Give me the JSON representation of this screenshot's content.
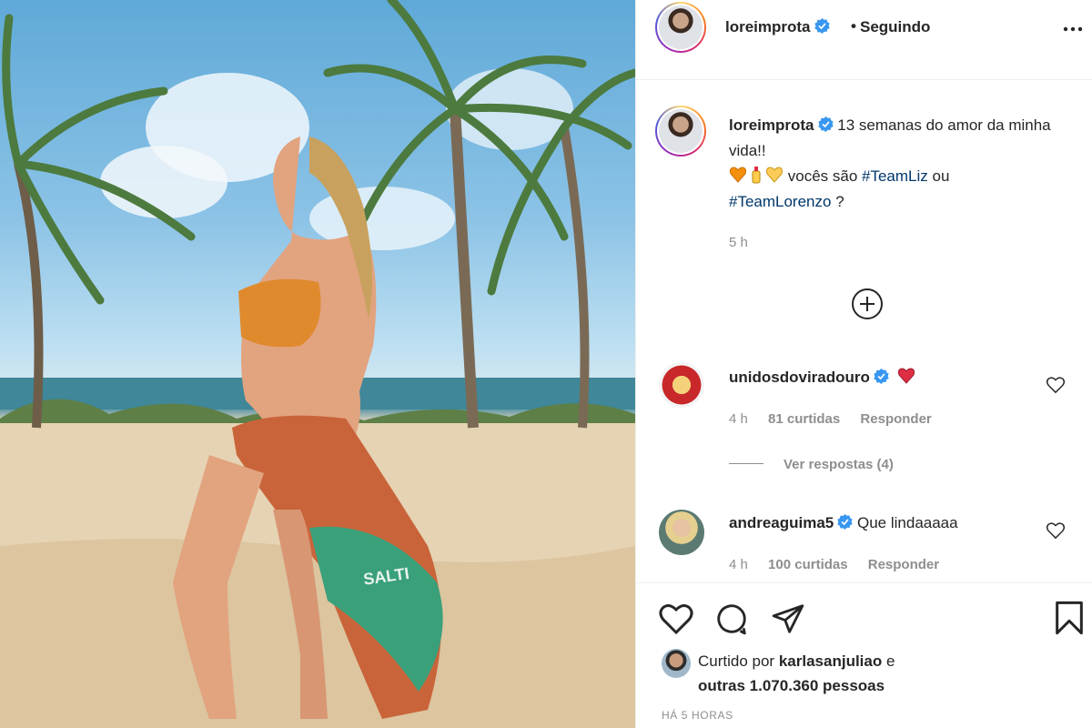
{
  "post": {
    "photo_overlay_text": "SALTI"
  },
  "header": {
    "username": "loreimprota",
    "separator": "•",
    "follow_status": "Seguindo"
  },
  "caption": {
    "username": "loreimprota",
    "text_line1": "13 semanas do amor da minha vida!!",
    "text_mid": "vocês são",
    "hashtag1": "#TeamLiz",
    "connector": "ou",
    "hashtag2": "#TeamLorenzo",
    "end": "?",
    "time": "5 h"
  },
  "comments": [
    {
      "username": "unidosdoviradouro",
      "text": "",
      "time": "4 h",
      "likes": "81 curtidas",
      "reply": "Responder",
      "view_replies": "Ver respostas (4)"
    },
    {
      "username": "andreaguima5",
      "text": "Que lindaaaaa",
      "time": "4 h",
      "likes": "100 curtidas",
      "reply": "Responder"
    }
  ],
  "likes": {
    "prefix": "Curtido por",
    "user": "karlasanjuliao",
    "and": "e",
    "others": "outras 1.070.360 pessoas"
  },
  "posted_ago": "HÁ 5 HORAS",
  "colors": {
    "verified": "#3897f0",
    "hashtag": "#00376b",
    "muted": "#8e8e8e",
    "heart_red": "#ed4956"
  }
}
